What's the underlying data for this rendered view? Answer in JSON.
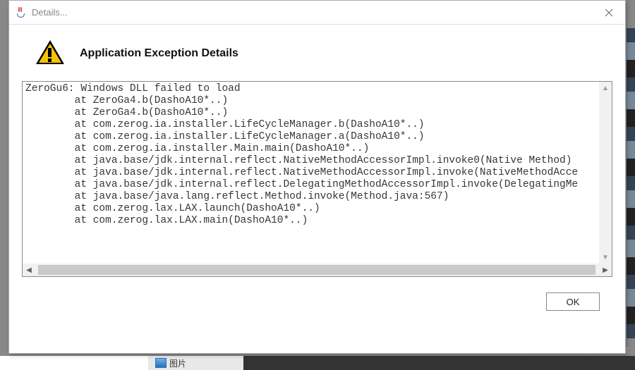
{
  "window": {
    "title": "Details..."
  },
  "header": {
    "text": "Application Exception Details"
  },
  "stack_trace": "ZeroGu6: Windows DLL failed to load\n        at ZeroGa4.b(DashoA10*..)\n        at ZeroGa4.b(DashoA10*..)\n        at com.zerog.ia.installer.LifeCycleManager.b(DashoA10*..)\n        at com.zerog.ia.installer.LifeCycleManager.a(DashoA10*..)\n        at com.zerog.ia.installer.Main.main(DashoA10*..)\n        at java.base/jdk.internal.reflect.NativeMethodAccessorImpl.invoke0(Native Method)\n        at java.base/jdk.internal.reflect.NativeMethodAccessorImpl.invoke(NativeMethodAcce\n        at java.base/jdk.internal.reflect.DelegatingMethodAccessorImpl.invoke(DelegatingMe\n        at java.base/java.lang.reflect.Method.invoke(Method.java:567)\n        at com.zerog.lax.LAX.launch(DashoA10*..)\n        at com.zerog.lax.LAX.main(DashoA10*..)",
  "buttons": {
    "ok": "OK"
  },
  "background": {
    "folder_label": "图片",
    "watermark": "https://blog.csdn.net/weixin_43196262"
  }
}
